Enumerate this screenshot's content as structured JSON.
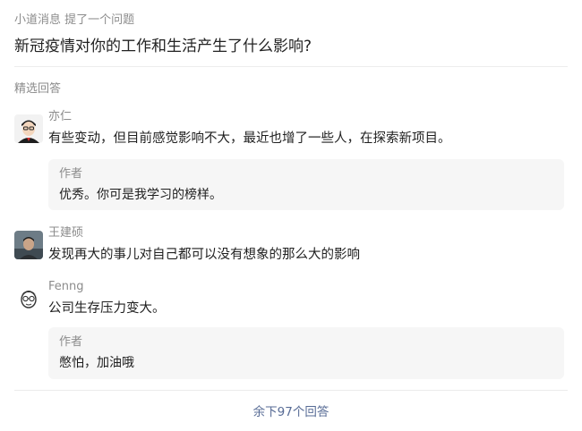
{
  "header": {
    "author": "小道消息",
    "action": "提了一个问题",
    "question": "新冠疫情对你的工作和生活产生了什么影响?"
  },
  "section_label": "精选回答",
  "answers": [
    {
      "name": "亦仁",
      "text": "有些变动，但目前感觉影响不大，最近也增了一些人，在探索新项目。",
      "reply": {
        "label": "作者",
        "text": "优秀。你可是我学习的榜样。"
      }
    },
    {
      "name": "王建硕",
      "text": "发现再大的事儿对自己都可以没有想象的那么大的影响"
    },
    {
      "name": "Fenng",
      "text": "公司生存压力变大。",
      "reply": {
        "label": "作者",
        "text": "憋怕，加油哦"
      }
    }
  ],
  "more_link": "余下97个回答",
  "colors": {
    "link": "#576b95",
    "muted": "#8c8c8c",
    "reply_bg": "#f6f6f6"
  },
  "icons": [
    "avatar-yiren",
    "avatar-wangjianshuo",
    "avatar-fenng"
  ]
}
